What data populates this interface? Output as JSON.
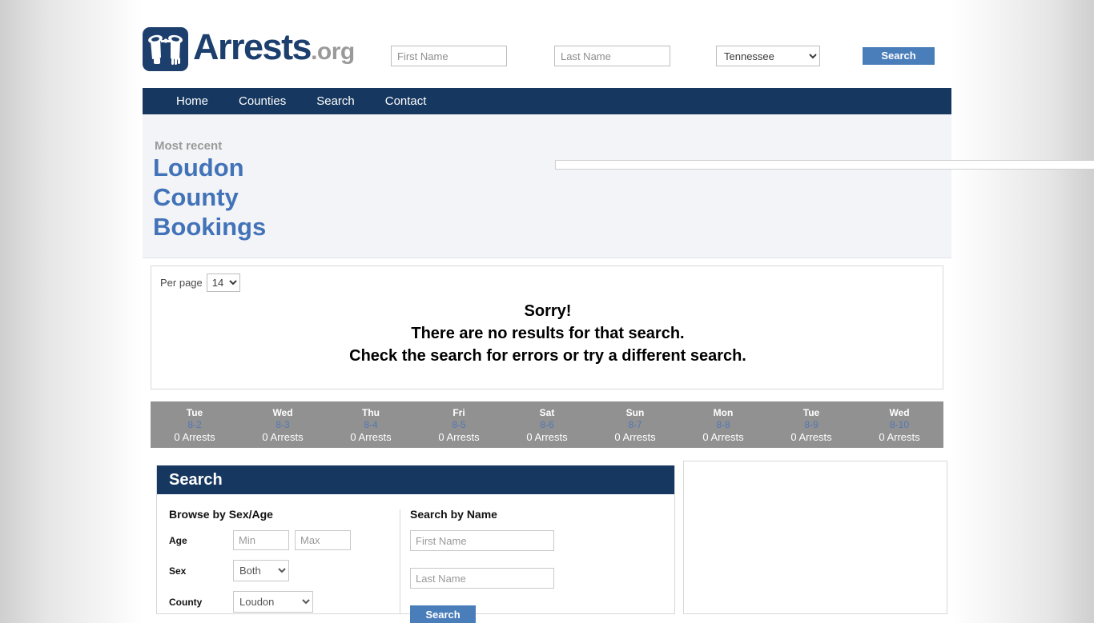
{
  "site": {
    "brand_name": "Arrests",
    "brand_suffix": ".org",
    "logo_icon": "handcuffs-icon",
    "brand_color": "#1d3f6e",
    "accent_blue": "#4a7ebb",
    "nav_bar_color": "#16375f",
    "day_bar_color": "#919191"
  },
  "header": {
    "first_name_placeholder": "First Name",
    "first_name_value": "",
    "last_name_placeholder": "Last Name",
    "last_name_value": "",
    "state_selected": "Tennessee",
    "state_options": [
      "Tennessee"
    ],
    "search_label": "Search"
  },
  "nav": {
    "items": [
      {
        "label": "Home"
      },
      {
        "label": "Counties"
      },
      {
        "label": "Search"
      },
      {
        "label": "Contact"
      }
    ]
  },
  "hero": {
    "eyebrow": "Most recent",
    "title": "Loudon County Bookings"
  },
  "results": {
    "per_page_label": "Per page",
    "per_page_value": "14",
    "per_page_options": [
      "14"
    ],
    "message_line1": "Sorry!",
    "message_line2": "There are no results for that search.",
    "message_line3": "Check the search for errors or try a different search."
  },
  "day_bar": {
    "days": [
      {
        "dow": "Tue",
        "date": "8-2",
        "count": "0 Arrests"
      },
      {
        "dow": "Wed",
        "date": "8-3",
        "count": "0 Arrests"
      },
      {
        "dow": "Thu",
        "date": "8-4",
        "count": "0 Arrests"
      },
      {
        "dow": "Fri",
        "date": "8-5",
        "count": "0 Arrests"
      },
      {
        "dow": "Sat",
        "date": "8-6",
        "count": "0 Arrests"
      },
      {
        "dow": "Sun",
        "date": "8-7",
        "count": "0 Arrests"
      },
      {
        "dow": "Mon",
        "date": "8-8",
        "count": "0 Arrests"
      },
      {
        "dow": "Tue",
        "date": "8-9",
        "count": "0 Arrests"
      },
      {
        "dow": "Wed",
        "date": "8-10",
        "count": "0 Arrests"
      }
    ]
  },
  "search_panel": {
    "title": "Search",
    "left": {
      "heading": "Browse by Sex/Age",
      "age_label": "Age",
      "age_min_placeholder": "Min",
      "age_min_value": "",
      "age_max_placeholder": "Max",
      "age_max_value": "",
      "sex_label": "Sex",
      "sex_selected": "Both",
      "sex_options": [
        "Both"
      ],
      "county_label": "County",
      "county_selected": "Loudon",
      "county_options": [
        "Loudon"
      ]
    },
    "right": {
      "heading": "Search by Name",
      "first_name_placeholder": "First Name",
      "first_name_value": "",
      "last_name_placeholder": "Last Name",
      "last_name_value": "",
      "submit_label": "Search"
    }
  }
}
